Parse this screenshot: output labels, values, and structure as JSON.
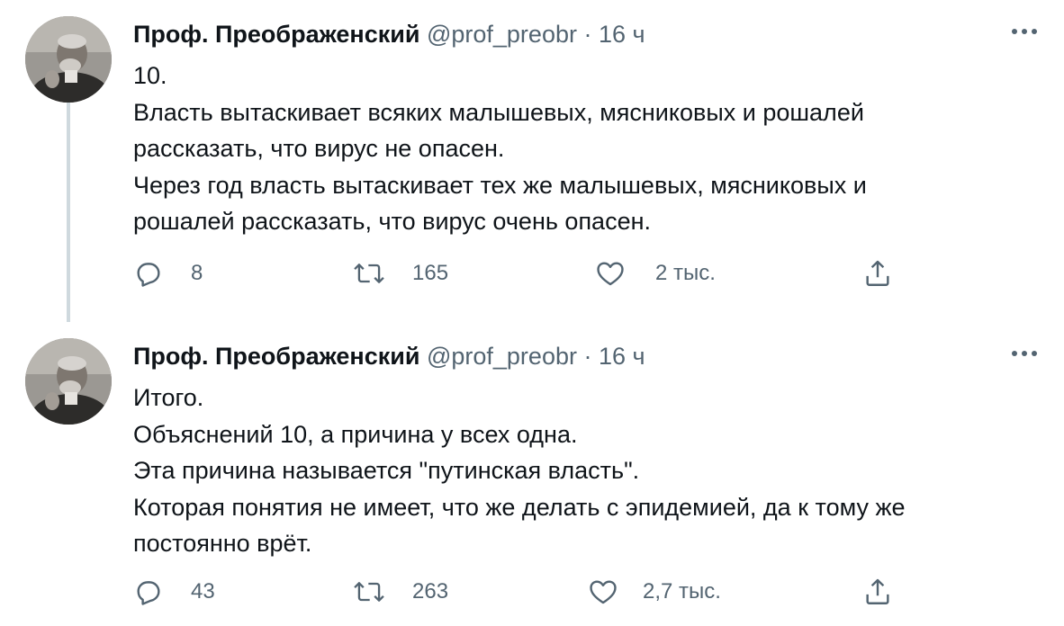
{
  "tweets": [
    {
      "author_name": "Проф. Преображенский",
      "handle": "@prof_preobr",
      "separator": "·",
      "time": "16 ч",
      "lines": [
        "10.",
        "Власть вытаскивает всяких малышевых, мясниковых и рошалей",
        "рассказать, что вирус не опасен.",
        "Через год власть вытаскивает тех же малышевых, мясниковых и",
        "рошалей рассказать, что вирус очень опасен."
      ],
      "replies": "8",
      "retweets": "165",
      "likes": "2 тыс."
    },
    {
      "author_name": "Проф. Преображенский",
      "handle": "@prof_preobr",
      "separator": "·",
      "time": "16 ч",
      "lines": [
        "Итого.",
        "Объяснений 10, а причина у всех одна.",
        "Эта причина называется \"путинская власть\".",
        "Которая понятия не имеет, что же делать с эпидемией, да к тому же",
        "постоянно врёт."
      ],
      "replies": "43",
      "retweets": "263",
      "likes": "2,7 тыс."
    }
  ],
  "icons": {
    "reply": "reply-icon",
    "retweet": "retweet-icon",
    "like": "heart-icon",
    "share": "share-icon",
    "more": "more-icon"
  },
  "colors": {
    "text": "#0f1419",
    "secondary": "#536471",
    "thread_line": "#cfd9de"
  }
}
